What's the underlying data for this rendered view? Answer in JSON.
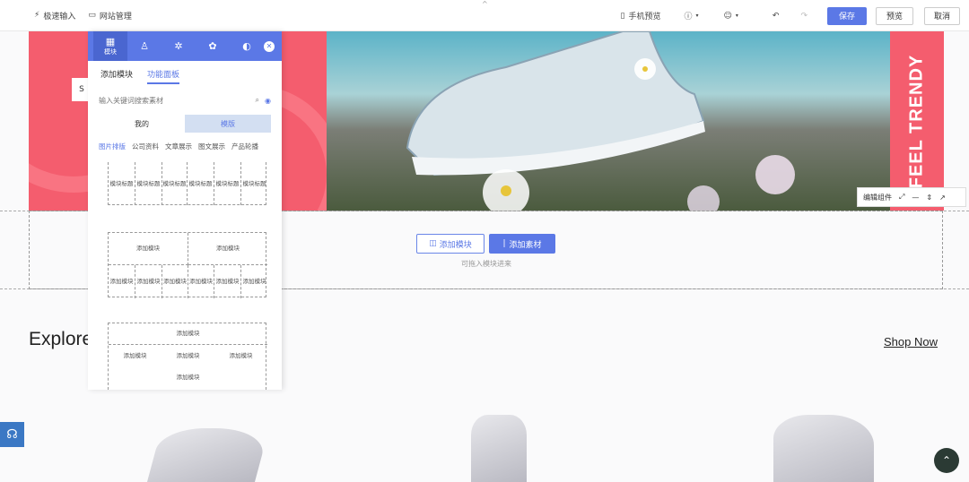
{
  "topbar": {
    "left_items": [
      "极速输入",
      "网站管理"
    ],
    "preview_label": "手机预览",
    "save_label": "保存",
    "publish_label": "预览",
    "cancel_label": "取消"
  },
  "banner": {
    "tag_text": "S",
    "right_text": "FEEL TRENDY",
    "toolbar_label": "编辑组件"
  },
  "empty_area": {
    "add_module_label": "添加模块",
    "add_material_label": "添加素材",
    "hint": "可拖入模块进来"
  },
  "section": {
    "title": "Explore",
    "link": "Shop Now"
  },
  "panel": {
    "head_label": "模块",
    "tabs": [
      "添加模块",
      "功能面板"
    ],
    "search_placeholder": "输入关键词搜索素材",
    "segments": [
      "我的",
      "模版"
    ],
    "categories": [
      "图片排版",
      "公司资料",
      "文章展示",
      "图文展示",
      "产品轮播"
    ],
    "template1_cells": [
      "模块标题",
      "模块标题",
      "模块标题",
      "模块标题",
      "模块标题",
      "模块标题"
    ],
    "template2_top": [
      "添加模块",
      "添加模块"
    ],
    "template2_cells": [
      "添加模块",
      "添加模块",
      "添加模块",
      "添加模块",
      "添加模块",
      "添加模块"
    ],
    "template3_top": "添加模块",
    "template3_cells": [
      "添加模块",
      "添加模块",
      "添加模块"
    ],
    "template3_bottom": "添加模块"
  },
  "colors": {
    "accent": "#5b78e6",
    "banner_pink": "#f45d6e"
  }
}
